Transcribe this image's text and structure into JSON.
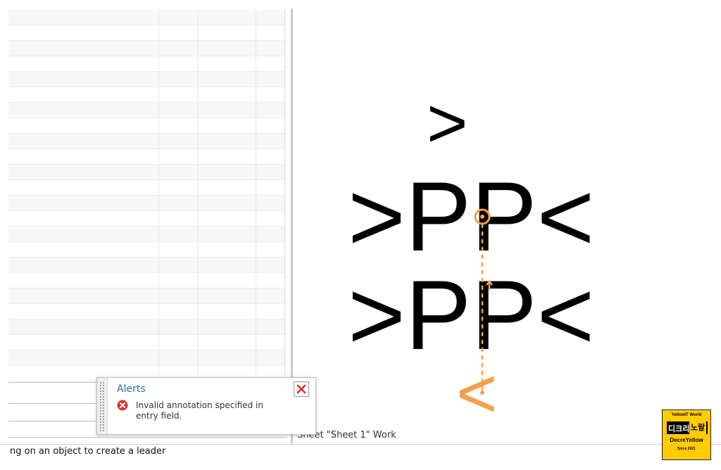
{
  "canvas": {
    "glyph_top": ">",
    "row1": ">PP<",
    "row2": ">PP<",
    "glyph_bottom": "<"
  },
  "colors": {
    "accent_orange": "#f5a04a",
    "alert_title": "#1c6fb0",
    "error_red": "#d9342b",
    "logo_yellow": "#ffcc00"
  },
  "alert": {
    "title": "Alerts",
    "message": "Invalid annotation specified in entry field.",
    "icon": "error-icon",
    "close_icon": "close-icon"
  },
  "status": {
    "hint": "ng on an object to create a leader",
    "sheet_label": "Sheet \"Sheet 1\" Work"
  },
  "logo": {
    "top_text": "YellowIT World",
    "left_text": "디크리",
    "right_text": "노랄",
    "brand": "DecreYellow",
    "since": "Since 2021"
  }
}
